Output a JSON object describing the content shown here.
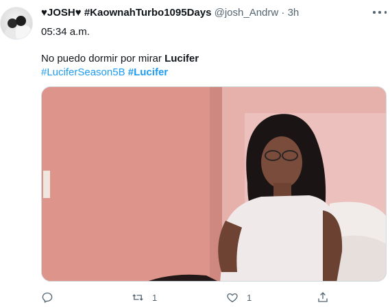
{
  "tweet": {
    "author": {
      "display_name": "♥JOSH♥ #KaownahTurbo1095Days",
      "handle": "@josh_Andrw",
      "separator": "·",
      "time": "3h"
    },
    "subline": "05:34 a.m.",
    "text_plain": "No puedo dormir por mirar ",
    "text_bold": "Lucifer",
    "hashtags": [
      {
        "label": "#LuciferSeason5B",
        "bold": false
      },
      {
        "label": "#Lucifer",
        "bold": true
      }
    ],
    "media": {
      "kind": "image",
      "icon": "photo"
    },
    "actions": {
      "reply_count": "",
      "retweet_count": "1",
      "like_count": "1",
      "share_count": ""
    }
  },
  "colors": {
    "link": "#1d9bf0",
    "muted": "#536471",
    "text": "#0f1419"
  }
}
